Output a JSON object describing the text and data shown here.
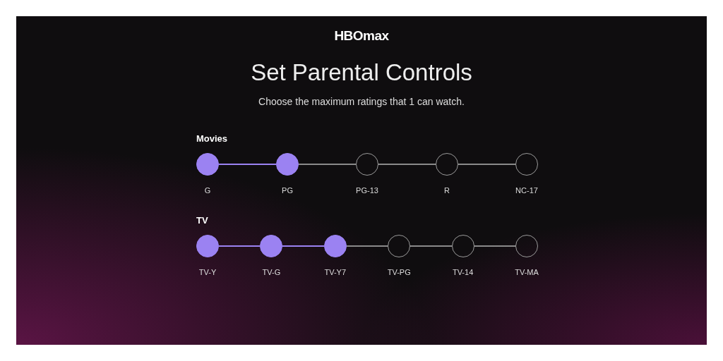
{
  "logo": "HBOmax",
  "title": "Set Parental Controls",
  "subtitle": "Choose the maximum ratings that 1 can watch.",
  "groups": [
    {
      "label": "Movies",
      "ratings": [
        {
          "label": "G",
          "selected": true
        },
        {
          "label": "PG",
          "selected": true
        },
        {
          "label": "PG-13",
          "selected": false
        },
        {
          "label": "R",
          "selected": false
        },
        {
          "label": "NC-17",
          "selected": false
        }
      ]
    },
    {
      "label": "TV",
      "ratings": [
        {
          "label": "TV-Y",
          "selected": true
        },
        {
          "label": "TV-G",
          "selected": true
        },
        {
          "label": "TV-Y7",
          "selected": true
        },
        {
          "label": "TV-PG",
          "selected": false
        },
        {
          "label": "TV-14",
          "selected": false
        },
        {
          "label": "TV-MA",
          "selected": false
        }
      ]
    }
  ]
}
